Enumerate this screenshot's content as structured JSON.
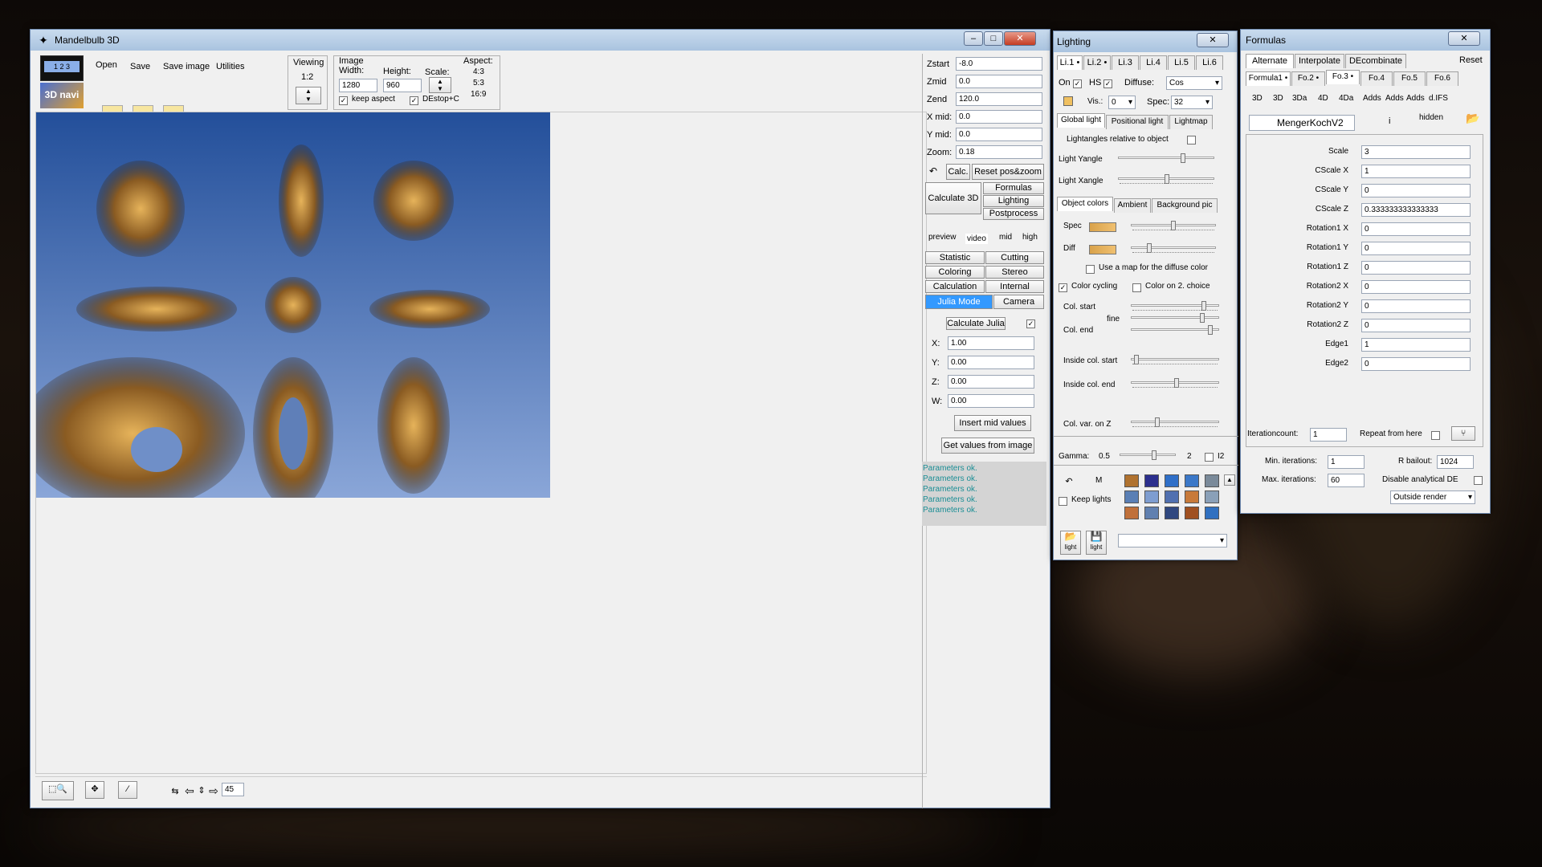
{
  "main": {
    "title": "Mandelbulb 3D",
    "menu": [
      "Open",
      "Save",
      "Save image",
      "Utilities"
    ],
    "viewing_label": "Viewing",
    "viewing_value": "1:2",
    "image_label": "Image",
    "width_label": "Width:",
    "height_label": "Height:",
    "width": "1280",
    "height": "960",
    "scale_label": "Scale:",
    "aspect_label": "Aspect:",
    "aspects": [
      "4:3",
      "5:3",
      "16:9"
    ],
    "keep_aspect": "keep aspect",
    "destop": "DEstop+C",
    "navi_label": "3D navi",
    "navi_nums": "1 2 3",
    "params": [
      {
        "l": "Zstart",
        "v": "-8.0"
      },
      {
        "l": "Zmid",
        "v": "0.0"
      },
      {
        "l": "Zend",
        "v": "120.0"
      },
      {
        "l": "X mid:",
        "v": "0.0"
      },
      {
        "l": "Y mid:",
        "v": "0.0"
      },
      {
        "l": "Zoom:",
        "v": "0.18"
      }
    ],
    "calc_btn": "Calc.",
    "reset_btn": "Reset pos&zoom",
    "calculate3d": "Calculate 3D",
    "side_btns": [
      "Formulas",
      "Lighting",
      "Postprocess"
    ],
    "quality": [
      "preview",
      "video",
      "mid",
      "high"
    ],
    "modes": [
      [
        "Statistic",
        "Cutting"
      ],
      [
        "Coloring",
        "Stereo"
      ],
      [
        "Calculation",
        "Internal"
      ],
      [
        "Julia Mode",
        "Camera"
      ]
    ],
    "calc_julia": "Calculate Julia",
    "julia": [
      {
        "l": "X:",
        "v": "1.00"
      },
      {
        "l": "Y:",
        "v": "0.00"
      },
      {
        "l": "Z:",
        "v": "0.00"
      },
      {
        "l": "W:",
        "v": "0.00"
      }
    ],
    "insert_mid": "Insert mid values",
    "get_values": "Get values from image",
    "status": [
      "Parameters ok.",
      "Parameters ok.",
      "Parameters ok.",
      "Parameters ok.",
      "Parameters ok."
    ],
    "step_value": "45"
  },
  "lighting": {
    "title": "Lighting",
    "tabs": [
      "Li.1 •",
      "Li.2 •",
      "Li.3",
      "Li.4",
      "Li.5",
      "Li.6"
    ],
    "on": "On",
    "hs": "HS",
    "diffuse": "Diffuse:",
    "diffuse_val": "Cos",
    "vis": "Vis.:",
    "vis_val": "0",
    "spec": "Spec:",
    "spec_val": "32",
    "light_tabs": [
      "Global light",
      "Positional light",
      "Lightmap"
    ],
    "lightangles": "Lightangles relative to object",
    "yangle": "Light Yangle",
    "xangle": "Light Xangle",
    "color_tabs": [
      "Object colors",
      "Ambient",
      "Background pic"
    ],
    "spec_l": "Spec",
    "diff_l": "Diff",
    "use_map": "Use a map for the diffuse color",
    "color_cycling": "Color cycling",
    "color_on2": "Color on 2. choice",
    "col_start": "Col. start",
    "fine": "fine",
    "col_end": "Col. end",
    "inside_start": "Inside col. start",
    "inside_end": "Inside col. end",
    "col_var": "Col. var. on Z",
    "gamma": "Gamma:",
    "gamma_val": "0.5",
    "two": "2",
    "i2": "I2",
    "m": "M",
    "keep_lights": "Keep lights",
    "light_btn": "light",
    "preset_colors": [
      "#b0722f",
      "#2b2f8e",
      "#2f6fc8",
      "#3b78c8",
      "#7a8a9a",
      "#5a7fb5",
      "#7e9dd0",
      "#5070b0",
      "#c87a3a",
      "#8aa0b8",
      "#c0703a",
      "#6080b0",
      "#304880",
      "#a05020",
      "#3070c0"
    ]
  },
  "formulas": {
    "title": "Formulas",
    "top_tabs": [
      "Alternate",
      "Interpolate",
      "DEcombinate"
    ],
    "reset": "Reset",
    "fo_tabs": [
      "Formula1 •",
      "Fo.2 •",
      "Fo.3 •",
      "Fo.4",
      "Fo.5",
      "Fo.6"
    ],
    "dims": [
      "3D",
      "3D",
      "3Da",
      "4D",
      "4Da",
      "Adds",
      "Adds",
      "Adds",
      "d.IFS"
    ],
    "name": "MengerKochV2",
    "info": "i",
    "hidden": "hidden",
    "params": [
      {
        "l": "Scale",
        "v": "3"
      },
      {
        "l": "CScale X",
        "v": "1"
      },
      {
        "l": "CScale Y",
        "v": "0"
      },
      {
        "l": "CScale Z",
        "v": "0.333333333333333"
      },
      {
        "l": "Rotation1 X",
        "v": "0"
      },
      {
        "l": "Rotation1 Y",
        "v": "0"
      },
      {
        "l": "Rotation1 Z",
        "v": "0"
      },
      {
        "l": "Rotation2 X",
        "v": "0"
      },
      {
        "l": "Rotation2 Y",
        "v": "0"
      },
      {
        "l": "Rotation2 Z",
        "v": "0"
      },
      {
        "l": "Edge1",
        "v": "1"
      },
      {
        "l": "Edge2",
        "v": "0"
      }
    ],
    "iterationcount": "Iterationcount:",
    "iter_val": "1",
    "repeat": "Repeat from here",
    "min_iter": "Min. iterations:",
    "min_val": "1",
    "rbailout": "R bailout:",
    "rb_val": "1024",
    "max_iter": "Max. iterations:",
    "max_val": "60",
    "disable_de": "Disable analytical DE",
    "outside": "Outside render"
  }
}
